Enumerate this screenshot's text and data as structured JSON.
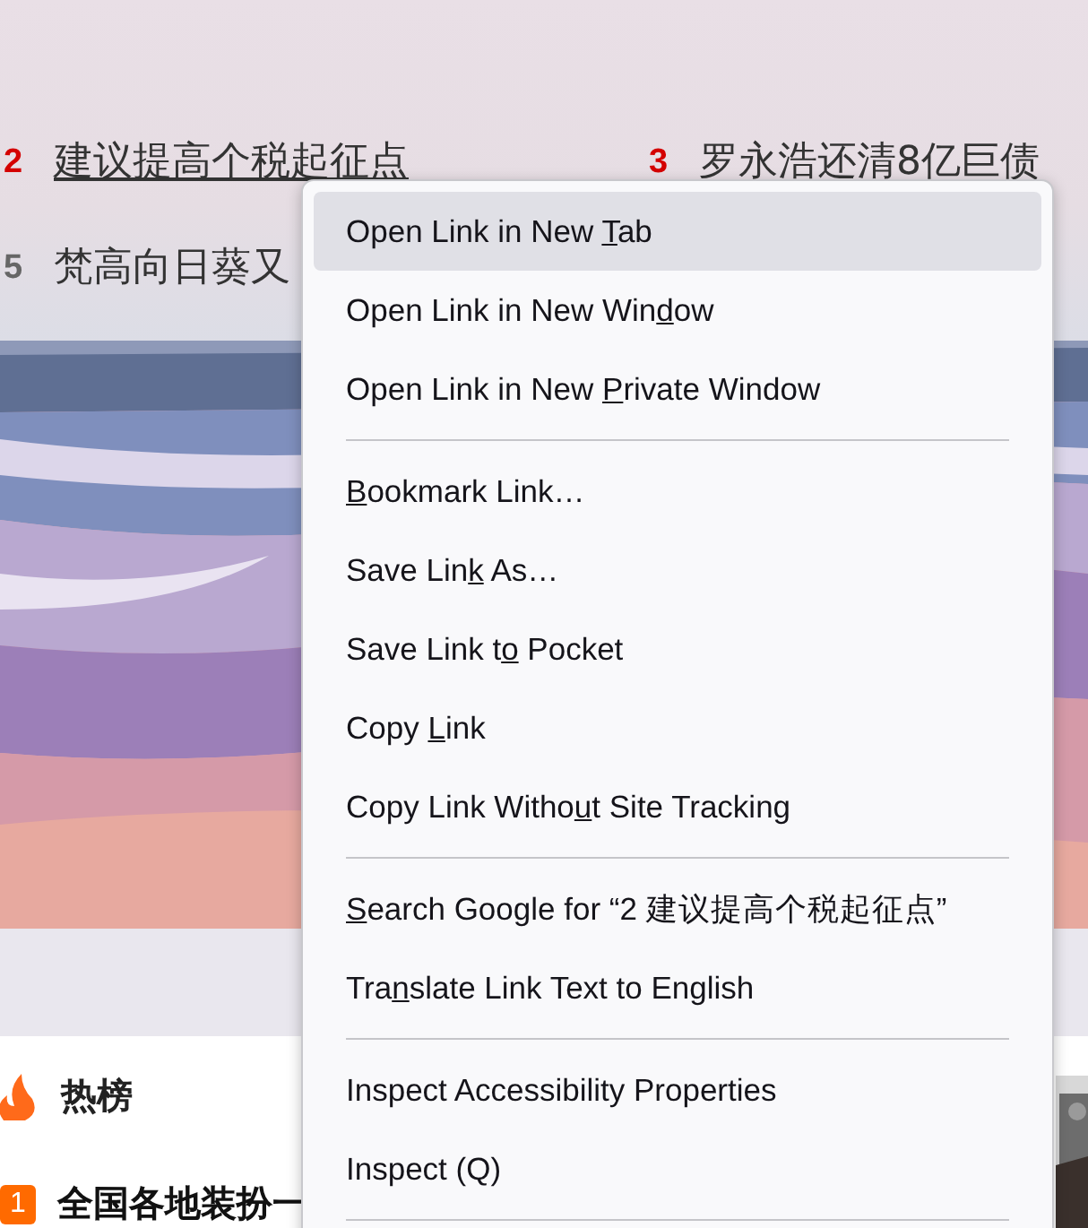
{
  "hot_list": [
    {
      "rank": "2",
      "title": "建议提高个税起征点",
      "color": "#d40000",
      "hovered": true
    },
    {
      "rank": "3",
      "title": "罗永浩还清8亿巨债",
      "color": "#d40000",
      "hovered": false
    },
    {
      "rank": "5",
      "title": "梵高向日葵又",
      "color": "#666666",
      "hovered": false
    }
  ],
  "hot_section": {
    "title": "热榜",
    "items": [
      {
        "rank": "1",
        "title": "全国各地装扮一"
      }
    ]
  },
  "context_menu": {
    "trailing_separator": true,
    "groups": [
      [
        {
          "label_start": "Open Link in New ",
          "access_key": "T",
          "label_end": "ab",
          "selected": true
        },
        {
          "label_start": "Open Link in New Win",
          "access_key": "d",
          "label_end": "ow",
          "selected": false
        },
        {
          "label_start": "Open Link in New ",
          "access_key": "P",
          "label_end": "rivate Window",
          "selected": false
        }
      ],
      [
        {
          "access_key": "B",
          "label_end": "ookmark Link…",
          "selected": false
        },
        {
          "label_start": "Save Lin",
          "access_key": "k",
          "label_end": " As…",
          "selected": false
        },
        {
          "label_start": "Save Link t",
          "access_key": "o",
          "label_end": " Pocket",
          "selected": false
        },
        {
          "label_start": "Copy ",
          "access_key": "L",
          "label_end": "ink",
          "selected": false
        },
        {
          "label_start": "Copy Link Witho",
          "access_key": "u",
          "label_end": "t Site Tracking",
          "selected": false
        }
      ],
      [
        {
          "access_key": "S",
          "label_end": "earch Google for “2 建议提高个税起征点”",
          "selected": false
        },
        {
          "label_start": "Tra",
          "access_key": "n",
          "label_end": "slate Link Text to English",
          "selected": false
        }
      ],
      [
        {
          "label_start": "Inspect Accessibility Properties",
          "selected": false
        },
        {
          "label_start": "Inspect (Q)",
          "selected": false
        }
      ]
    ]
  }
}
